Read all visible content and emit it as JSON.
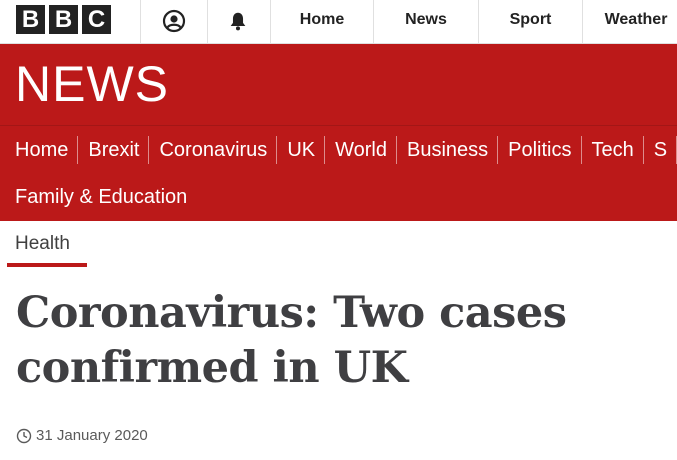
{
  "global_nav": {
    "logo_letters": [
      "B",
      "B",
      "C"
    ],
    "items": [
      "Home",
      "News",
      "Sport",
      "Weather"
    ],
    "icons": [
      "account-icon",
      "notifications-bell-icon"
    ]
  },
  "masthead": {
    "title": "NEWS"
  },
  "section_nav": {
    "items": [
      "Home",
      "Brexit",
      "Coronavirus",
      "UK",
      "World",
      "Business",
      "Politics",
      "Tech",
      "S"
    ],
    "second_row": "Family & Education"
  },
  "subsection": {
    "label": "Health"
  },
  "article": {
    "headline": "Coronavirus: Two cases confirmed in UK",
    "date": "31 January 2020"
  },
  "colors": {
    "brand_red": "#bb1919",
    "text_dark": "#3f3f42"
  }
}
